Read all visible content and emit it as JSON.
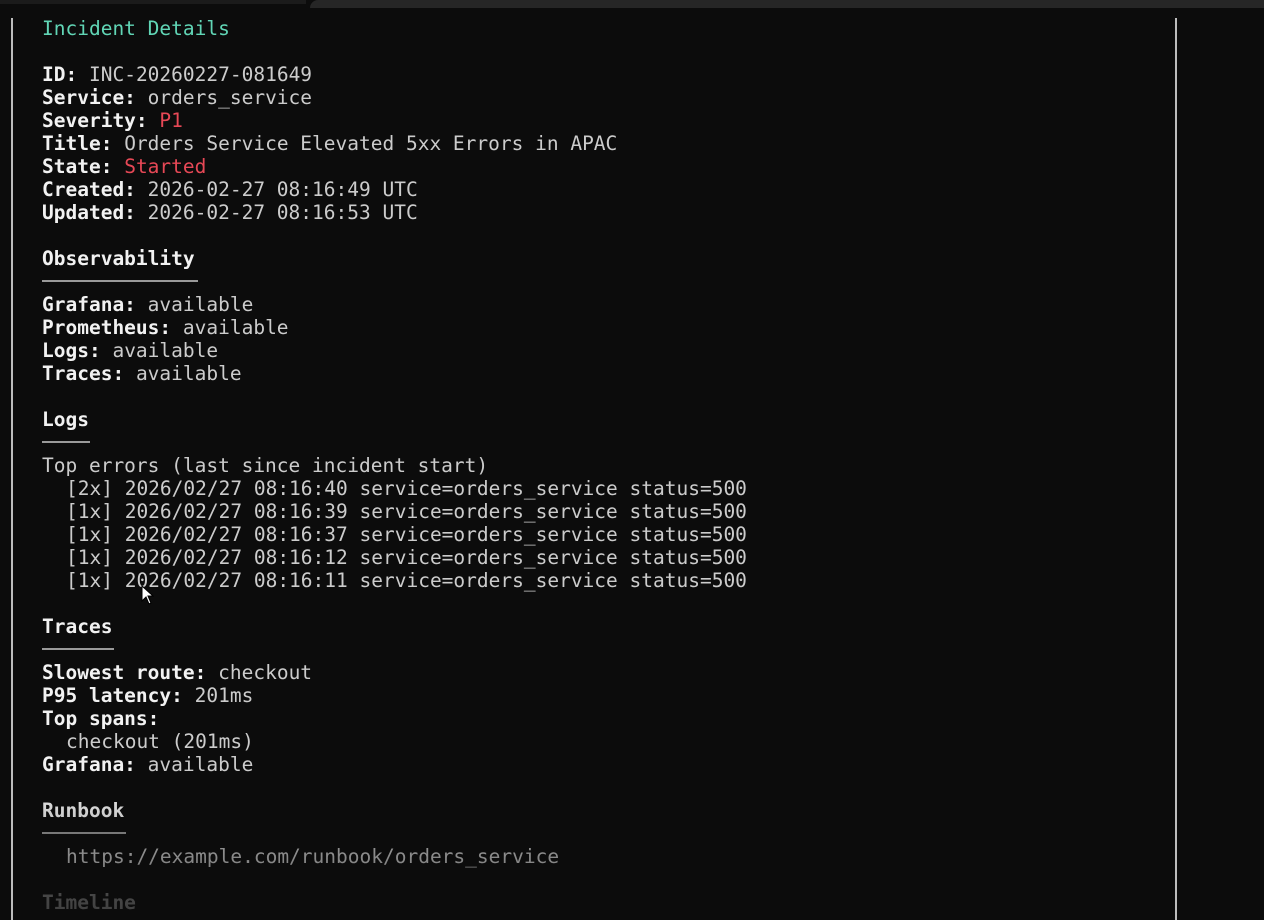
{
  "header": {
    "title": "Incident Details"
  },
  "incident": {
    "id_label": "ID:",
    "id_value": "INC-20260227-081649",
    "service_label": "Service:",
    "service_value": "orders_service",
    "severity_label": "Severity:",
    "severity_value": "P1",
    "title_label": "Title:",
    "title_value": "Orders Service Elevated 5xx Errors in APAC",
    "state_label": "State:",
    "state_value": "Started",
    "created_label": "Created:",
    "created_value": "2026-02-27 08:16:49 UTC",
    "updated_label": "Updated:",
    "updated_value": "2026-02-27 08:16:53 UTC"
  },
  "observability": {
    "heading": "Observability",
    "items": [
      {
        "label": "Grafana:",
        "value": "available"
      },
      {
        "label": "Prometheus:",
        "value": "available"
      },
      {
        "label": "Logs:",
        "value": "available"
      },
      {
        "label": "Traces:",
        "value": "available"
      }
    ]
  },
  "logs": {
    "heading": "Logs",
    "subheading": "Top errors (last since incident start)",
    "entries": [
      "[2x] 2026/02/27 08:16:40 service=orders_service status=500",
      "[1x] 2026/02/27 08:16:39 service=orders_service status=500",
      "[1x] 2026/02/27 08:16:37 service=orders_service status=500",
      "[1x] 2026/02/27 08:16:12 service=orders_service status=500",
      "[1x] 2026/02/27 08:16:11 service=orders_service status=500"
    ]
  },
  "traces": {
    "heading": "Traces",
    "slowest_route_label": "Slowest route:",
    "slowest_route_value": "checkout",
    "p95_label": "P95 latency:",
    "p95_value": "201ms",
    "top_spans_label": "Top spans:",
    "top_span_item": "checkout (201ms)",
    "grafana_label": "Grafana:",
    "grafana_value": "available"
  },
  "runbook": {
    "heading": "Runbook",
    "url": "https://example.com/runbook/orders_service"
  },
  "timeline": {
    "heading": "Timeline"
  },
  "colors": {
    "background": "#0c0c0c",
    "title_accent": "#61d6b6",
    "alert_red": "#e74856",
    "text": "#cccccc",
    "bold_text": "#f2f2f2"
  },
  "icons": {
    "cursor": "mouse-pointer-icon"
  }
}
